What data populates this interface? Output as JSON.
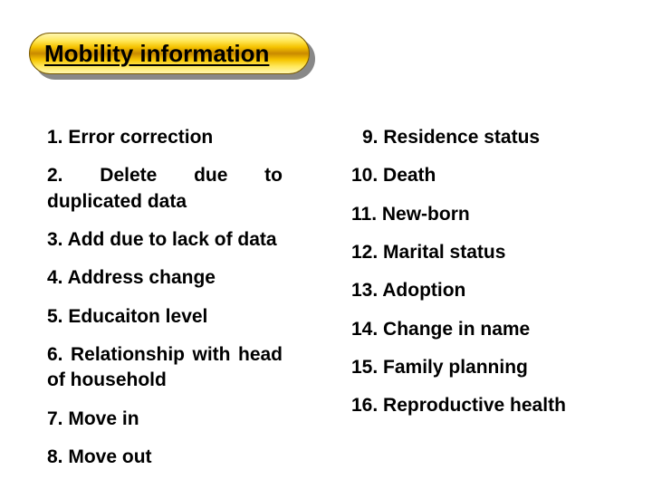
{
  "title": "Mobility information",
  "left_items": [
    "1. Error correction",
    "2. Delete due to duplicated data",
    "3. Add due to lack of data",
    "4. Address change",
    "5. Educaiton level",
    "6. Relationship with head of household",
    "7. Move in",
    "8. Move out"
  ],
  "right_items": [
    "9. Residence status",
    "10. Death",
    "11. New-born",
    "12. Marital status",
    "13. Adoption",
    "14. Change in name",
    "15. Family planning",
    "16. Reproductive health"
  ]
}
